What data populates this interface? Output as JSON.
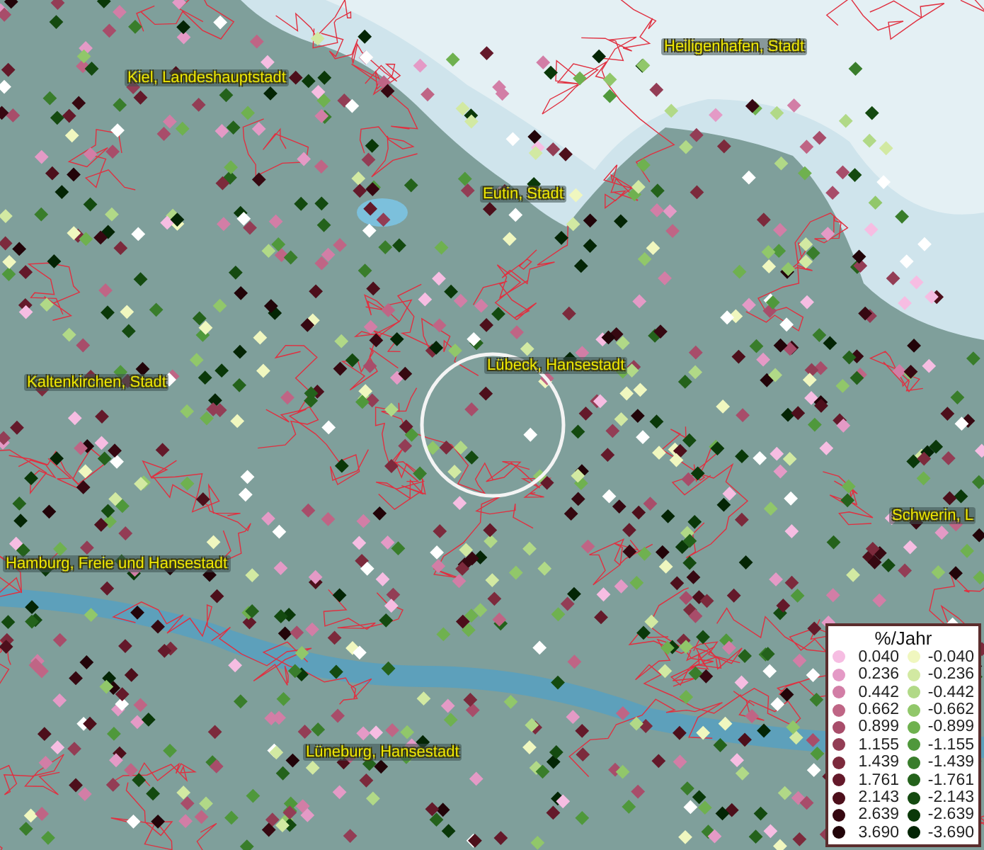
{
  "map": {
    "places": [
      {
        "name": "Heiligenhafen, Stadt"
      },
      {
        "name": "Kiel, Landeshauptstadt"
      },
      {
        "name": "Eutin, Stadt"
      },
      {
        "name": "Kaltenkirchen, Stadt"
      },
      {
        "name": "Lübeck, Hansestadt"
      },
      {
        "name": "Schwerin, L"
      },
      {
        "name": "Hamburg, Freie und Hansestadt"
      },
      {
        "name": "Lüneburg, Hansestadt"
      }
    ]
  },
  "legend": {
    "title": "%/Jahr",
    "positive": [
      {
        "value": "0.040",
        "color": "#f6bde2"
      },
      {
        "value": "0.236",
        "color": "#e49ac6"
      },
      {
        "value": "0.442",
        "color": "#d27ea6"
      },
      {
        "value": "0.662",
        "color": "#bf6585"
      },
      {
        "value": "0.899",
        "color": "#a84d6a"
      },
      {
        "value": "1.155",
        "color": "#933d55"
      },
      {
        "value": "1.439",
        "color": "#7c2a3c"
      },
      {
        "value": "1.761",
        "color": "#64192a"
      },
      {
        "value": "2.143",
        "color": "#4d0f1b"
      },
      {
        "value": "2.639",
        "color": "#360811"
      },
      {
        "value": "3.690",
        "color": "#220409"
      }
    ],
    "negative": [
      {
        "value": "-0.040",
        "color": "#f0f7bf"
      },
      {
        "value": "-0.236",
        "color": "#d2e9a2"
      },
      {
        "value": "-0.442",
        "color": "#b1d987"
      },
      {
        "value": "-0.662",
        "color": "#91c76a"
      },
      {
        "value": "-0.899",
        "color": "#6fb14f"
      },
      {
        "value": "-1.155",
        "color": "#4f983b"
      },
      {
        "value": "-1.439",
        "color": "#397d2b"
      },
      {
        "value": "-1.761",
        "color": "#24621b"
      },
      {
        "value": "-2.143",
        "color": "#144a10"
      },
      {
        "value": "-2.639",
        "color": "#0a3809"
      },
      {
        "value": "-3.690",
        "color": "#042505"
      }
    ]
  }
}
